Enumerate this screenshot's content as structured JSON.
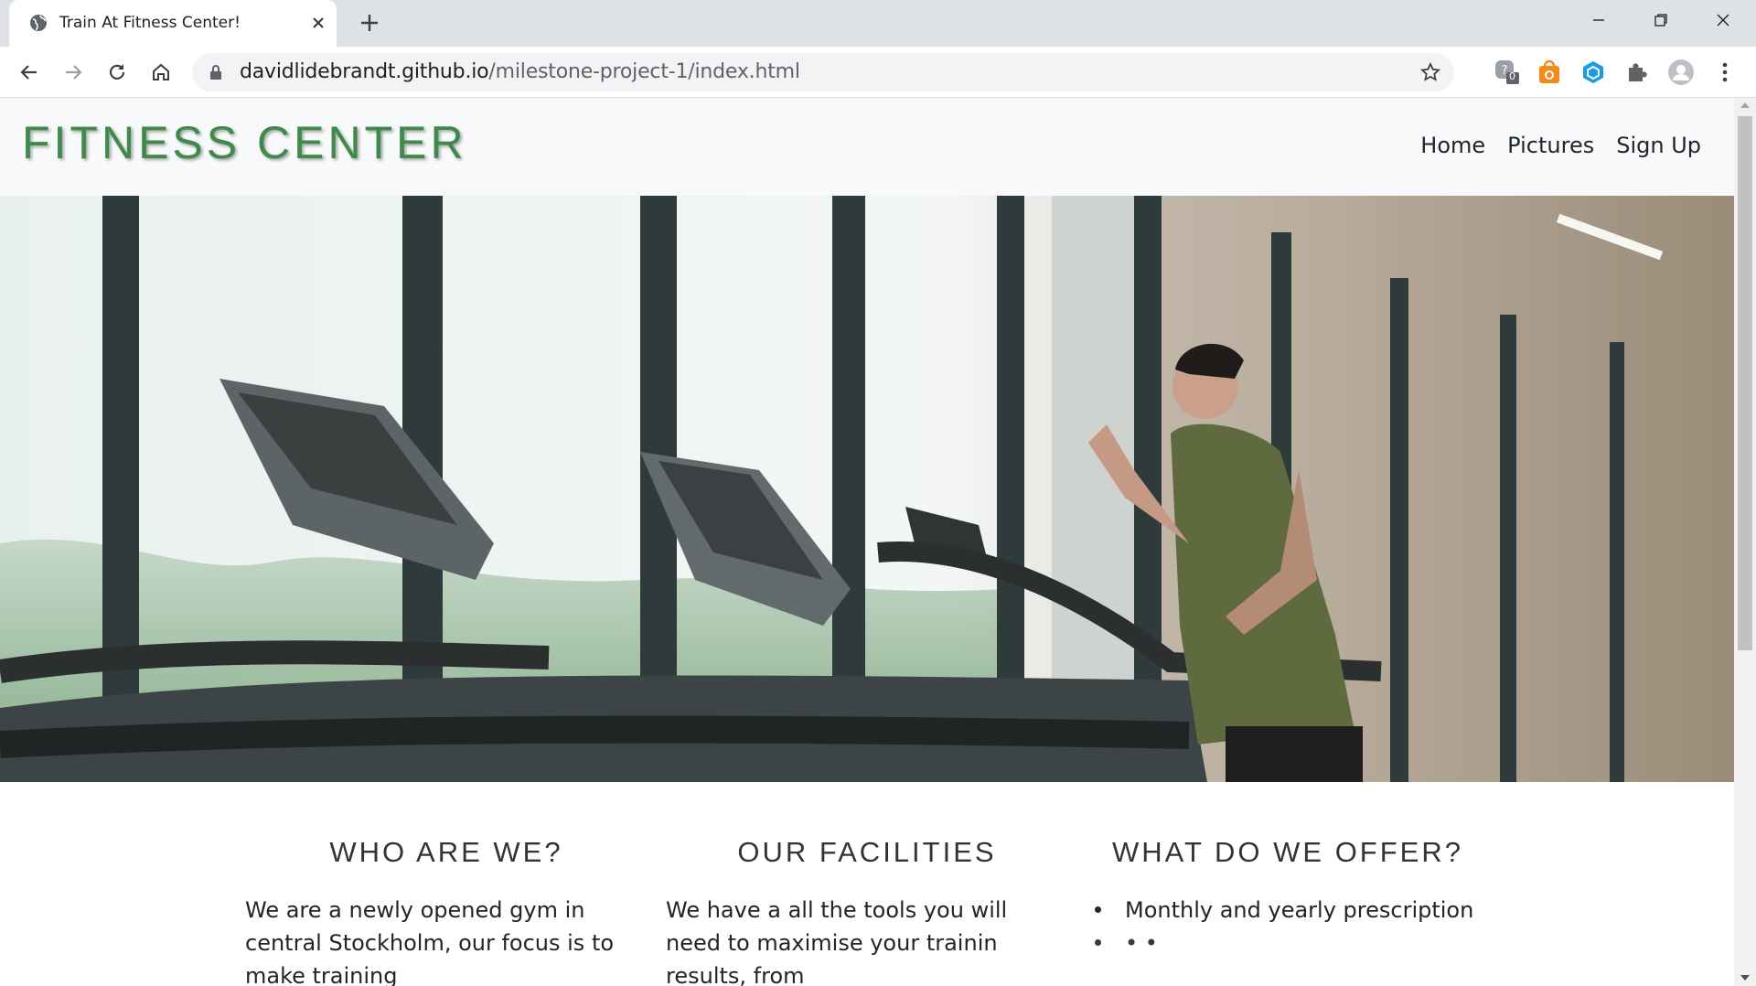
{
  "browser": {
    "tab_title": "Train At Fitness Center!",
    "url_host": "davidlidebrandt.github.io",
    "url_path": "/milestone-project-1/index.html",
    "extension_badge": "0"
  },
  "site": {
    "logo": "FITNESS CENTER",
    "nav": [
      "Home",
      "Pictures",
      "Sign Up"
    ]
  },
  "features": [
    {
      "heading": "WHO ARE WE?",
      "text": "We are a newly opened gym in central Stockholm, our focus is to make training"
    },
    {
      "heading": "OUR FACILITIES",
      "text": "We have a all the tools you will need to maximise your trainin results, from"
    },
    {
      "heading": "WHAT DO WE OFFER?",
      "items": [
        "Monthly and yearly prescription",
        "• •"
      ]
    }
  ],
  "colors": {
    "logo": "#3f8a4a",
    "header_bg": "#f8f9fa",
    "chrome_tabbar": "#dee1e6"
  }
}
